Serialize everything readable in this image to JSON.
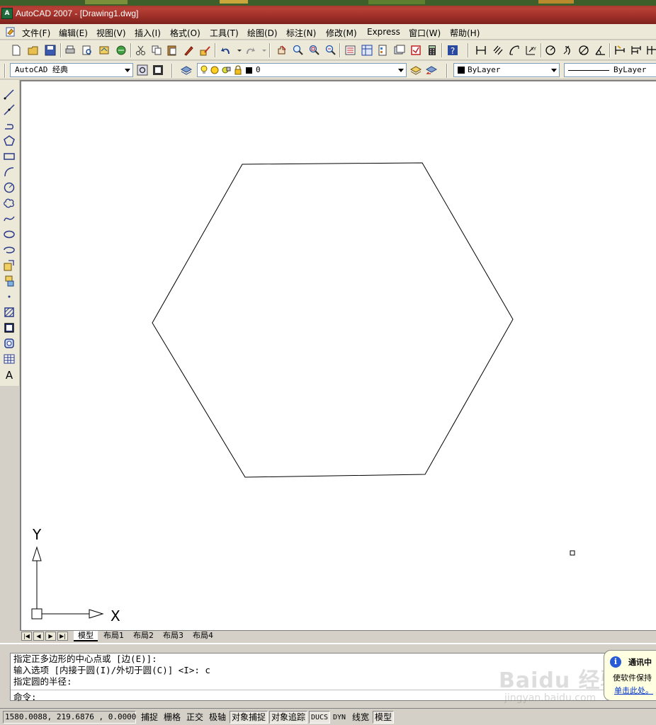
{
  "window": {
    "title": "AutoCAD 2007 - [Drawing1.dwg]"
  },
  "menu": [
    "文件(F)",
    "编辑(E)",
    "视图(V)",
    "插入(I)",
    "格式(O)",
    "工具(T)",
    "绘图(D)",
    "标注(N)",
    "修改(M)",
    "Express",
    "窗口(W)",
    "帮助(H)"
  ],
  "toolbar": {
    "workspace": "AutoCAD 经典",
    "layer_name": "0",
    "color": "ByLayer",
    "linetype": "ByLayer"
  },
  "tabs": {
    "model": "模型",
    "layouts": [
      "布局1",
      "布局2",
      "布局3",
      "布局4"
    ]
  },
  "ucs": {
    "y_label": "Y",
    "x_label": "X"
  },
  "command": {
    "history": [
      "指定正多边形的中心点或 [边(E)]:",
      "输入选项 [内接于圆(I)/外切于圆(C)] <I>: c",
      "指定圆的半径:"
    ],
    "prompt": "命令:"
  },
  "balloon": {
    "title": "通讯中",
    "text": "使软件保持",
    "link": "单击此处。"
  },
  "watermark": {
    "text": "Baidu 经验",
    "url": "jingyan.baidu.com"
  },
  "status": {
    "coords": "1580.0088, 219.6876 , 0.0000",
    "buttons": [
      {
        "label": "捕捉",
        "on": false
      },
      {
        "label": "栅格",
        "on": false
      },
      {
        "label": "正交",
        "on": false
      },
      {
        "label": "极轴",
        "on": false
      },
      {
        "label": "对象捕捉",
        "on": true
      },
      {
        "label": "对象追踪",
        "on": true
      },
      {
        "label": "DUCS",
        "on": true
      },
      {
        "label": "DYN",
        "on": false
      },
      {
        "label": "线宽",
        "on": false
      },
      {
        "label": "模型",
        "on": true
      }
    ]
  },
  "colors": {
    "titlebar": "#9d2f28",
    "chrome": "#ece9d8",
    "canvas": "#ffffff",
    "balloon": "#ffffe1"
  }
}
